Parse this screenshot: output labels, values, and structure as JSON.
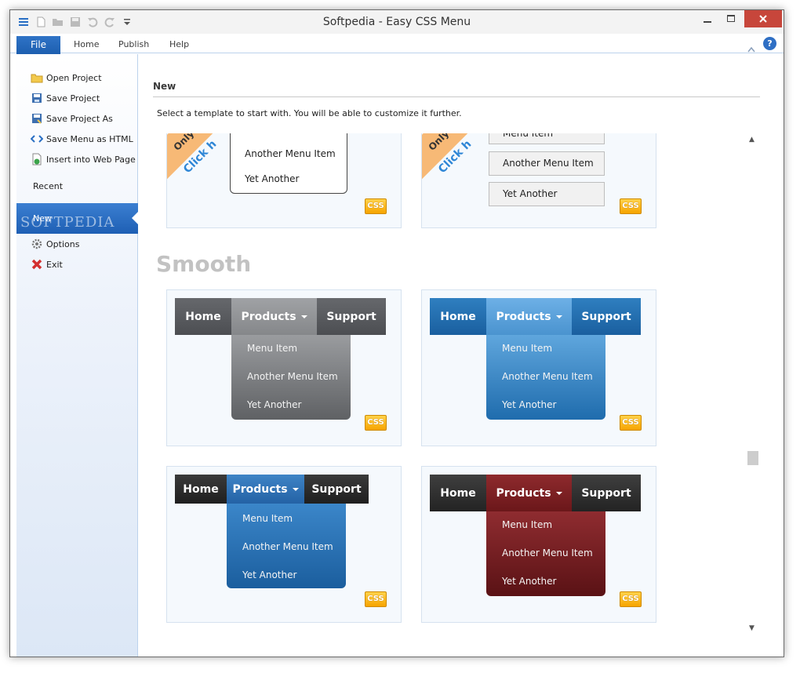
{
  "window": {
    "title": "Softpedia - Easy CSS Menu",
    "quick_access": [
      "menu-icon",
      "new-file-icon",
      "open-folder-icon",
      "save-icon",
      "undo-icon",
      "redo-icon",
      "customize-dropdown-icon"
    ]
  },
  "ribbon": {
    "tabs": [
      {
        "label": "File",
        "active": true
      },
      {
        "label": "Home"
      },
      {
        "label": "Publish"
      },
      {
        "label": "Help"
      }
    ]
  },
  "backstage": {
    "items": [
      {
        "label": "Open Project",
        "icon": "folder-open-icon"
      },
      {
        "label": "Save Project",
        "icon": "floppy-disk-icon"
      },
      {
        "label": "Save Project As",
        "icon": "floppy-disk-as-icon"
      },
      {
        "label": "Save Menu as HTML",
        "icon": "html-code-icon"
      },
      {
        "label": "Insert into Web Page",
        "icon": "web-page-insert-icon"
      }
    ],
    "recent": "Recent",
    "selected": "New",
    "options": {
      "label": "Options",
      "icon": "gear-icon"
    },
    "exit": {
      "label": "Exit",
      "icon": "red-x-icon"
    },
    "watermark": "SOFTPEDIA"
  },
  "content": {
    "heading": "New",
    "instruction": "Select a template to start with. You will be able to customize it further.",
    "section": "Smooth",
    "css_badge": "CSS",
    "partial_cards": [
      {
        "ribbon_line1": "Only",
        "ribbon_line2": "Click h",
        "items": [
          "Another Menu Item",
          "Yet Another"
        ]
      },
      {
        "ribbon_line1": "Only",
        "ribbon_line2": "Click h",
        "items": [
          "Menu Item",
          "Another Menu Item",
          "Yet Another"
        ]
      }
    ],
    "menu_templates": [
      {
        "nav": {
          "home": "Home",
          "products": "Products",
          "support": "Support"
        },
        "items": [
          "Menu Item",
          "Another Menu Item",
          "Yet Another"
        ],
        "colors": {
          "side": "#55575b",
          "active": "#8f9194",
          "sub": "#6f7174"
        }
      },
      {
        "nav": {
          "home": "Home",
          "products": "Products",
          "support": "Support"
        },
        "items": [
          "Menu Item",
          "Another Menu Item",
          "Yet Another"
        ],
        "colors": {
          "side": "#1f6cad",
          "active": "#59a0d9",
          "sub": "#3f86c3"
        }
      },
      {
        "nav": {
          "home": "Home",
          "products": "Products",
          "support": "Support"
        },
        "items": [
          "Menu Item",
          "Another Menu Item",
          "Yet Another"
        ],
        "colors": {
          "side": "#2b2b2b",
          "active": "#2d72b5",
          "sub": "#2a6fb2"
        }
      },
      {
        "nav": {
          "home": "Home",
          "products": "Products",
          "support": "Support"
        },
        "items": [
          "Menu Item",
          "Another Menu Item",
          "Yet Another"
        ],
        "colors": {
          "side": "#2f2f2f",
          "active": "#7e1f22",
          "sub": "#80262a"
        }
      }
    ]
  }
}
